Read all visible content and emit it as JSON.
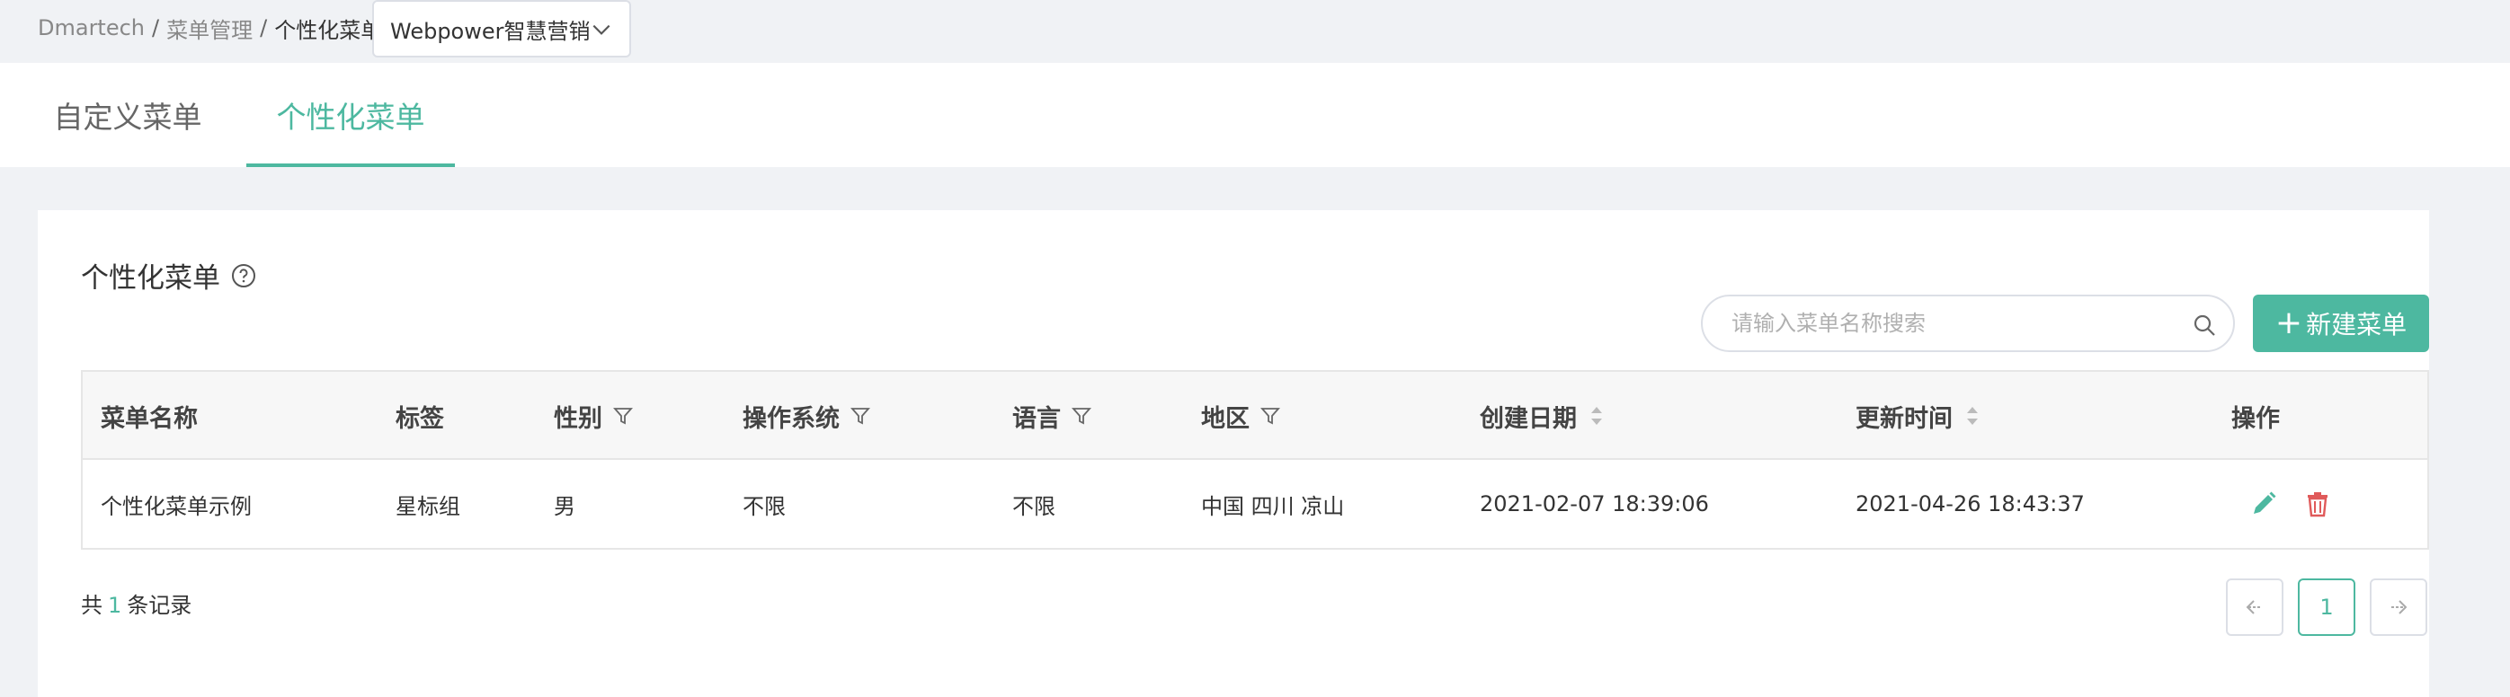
{
  "breadcrumb": {
    "root": "Dmartech",
    "sep": "/",
    "menu_mgmt": "菜单管理",
    "current": "个性化菜单"
  },
  "brand_select": {
    "value": "Webpower智慧营销"
  },
  "tabs": [
    {
      "label": "自定义菜单",
      "active": false
    },
    {
      "label": "个性化菜单",
      "active": true
    }
  ],
  "card": {
    "title": "个性化菜单"
  },
  "search": {
    "placeholder": "请输入菜单名称搜索",
    "value": ""
  },
  "new_button": {
    "plus": "+",
    "label": "新建菜单"
  },
  "table": {
    "columns": [
      "菜单名称",
      "标签",
      "性别",
      "操作系统",
      "语言",
      "地区",
      "创建日期",
      "更新时间",
      "操作"
    ],
    "rows": [
      {
        "name": "个性化菜单示例",
        "tag": "星标组",
        "gender": "男",
        "os": "不限",
        "language": "不限",
        "region": "中国 四川 凉山",
        "created": "2021-02-07 18:39:06",
        "updated": "2021-04-26 18:43:37"
      }
    ]
  },
  "footer": {
    "prefix": "共",
    "count": "1",
    "suffix": "条记录",
    "current_page": "1"
  },
  "colors": {
    "accent": "#4db8a0",
    "danger": "#e05a5a"
  }
}
